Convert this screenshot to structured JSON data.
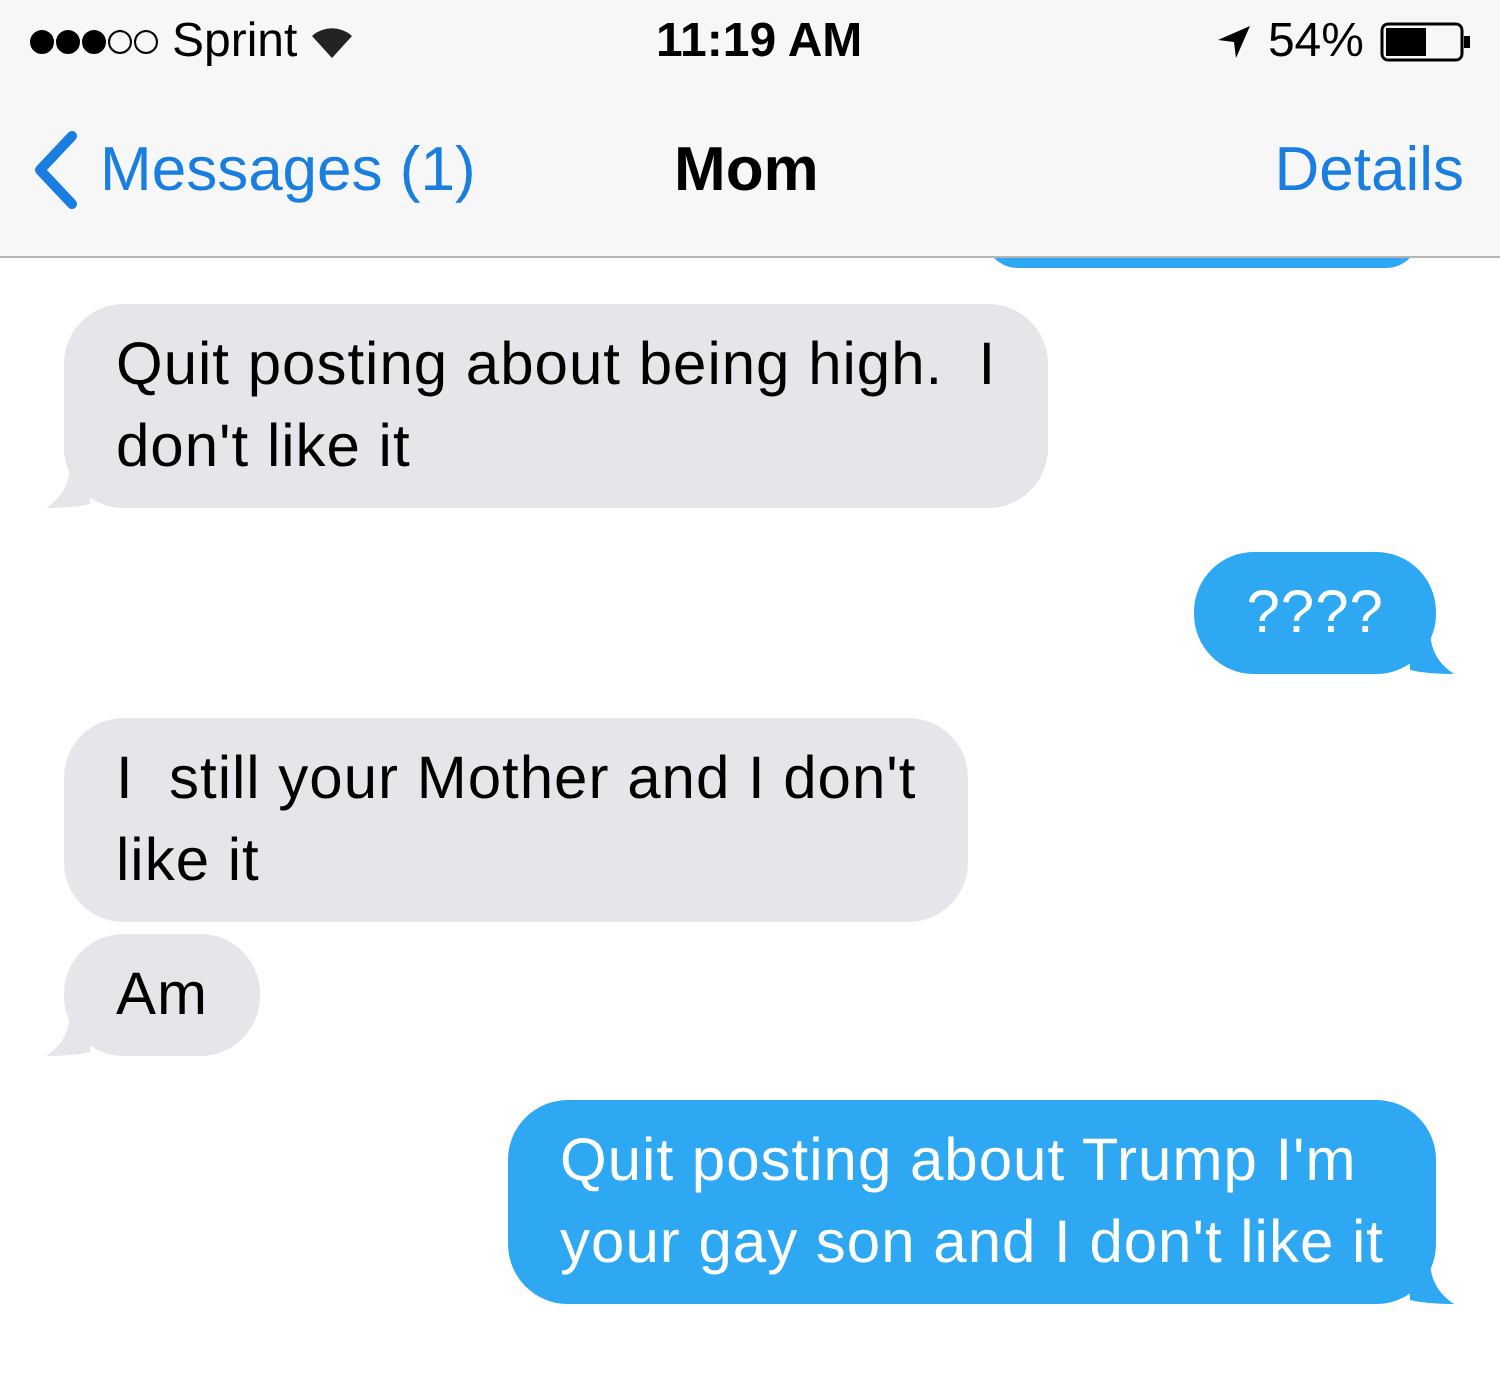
{
  "status_bar": {
    "carrier": "Sprint",
    "time": "11:19 AM",
    "battery": "54%"
  },
  "nav": {
    "back": "Messages (1)",
    "title": "Mom",
    "action": "Details"
  },
  "messages": [
    {
      "kind": "received",
      "text": "Quit posting about being high.  I\ndon't like it",
      "tail": true
    },
    {
      "kind": "sent",
      "text": "????",
      "tail": true
    },
    {
      "kind": "received",
      "text": "I  still your Mother and I don't\nlike it",
      "tail": false
    },
    {
      "kind": "received",
      "text": "Am",
      "tail": true
    },
    {
      "kind": "sent",
      "text": "Quit posting about Trump I'm\nyour gay son and I don't like it",
      "tail": true
    }
  ]
}
